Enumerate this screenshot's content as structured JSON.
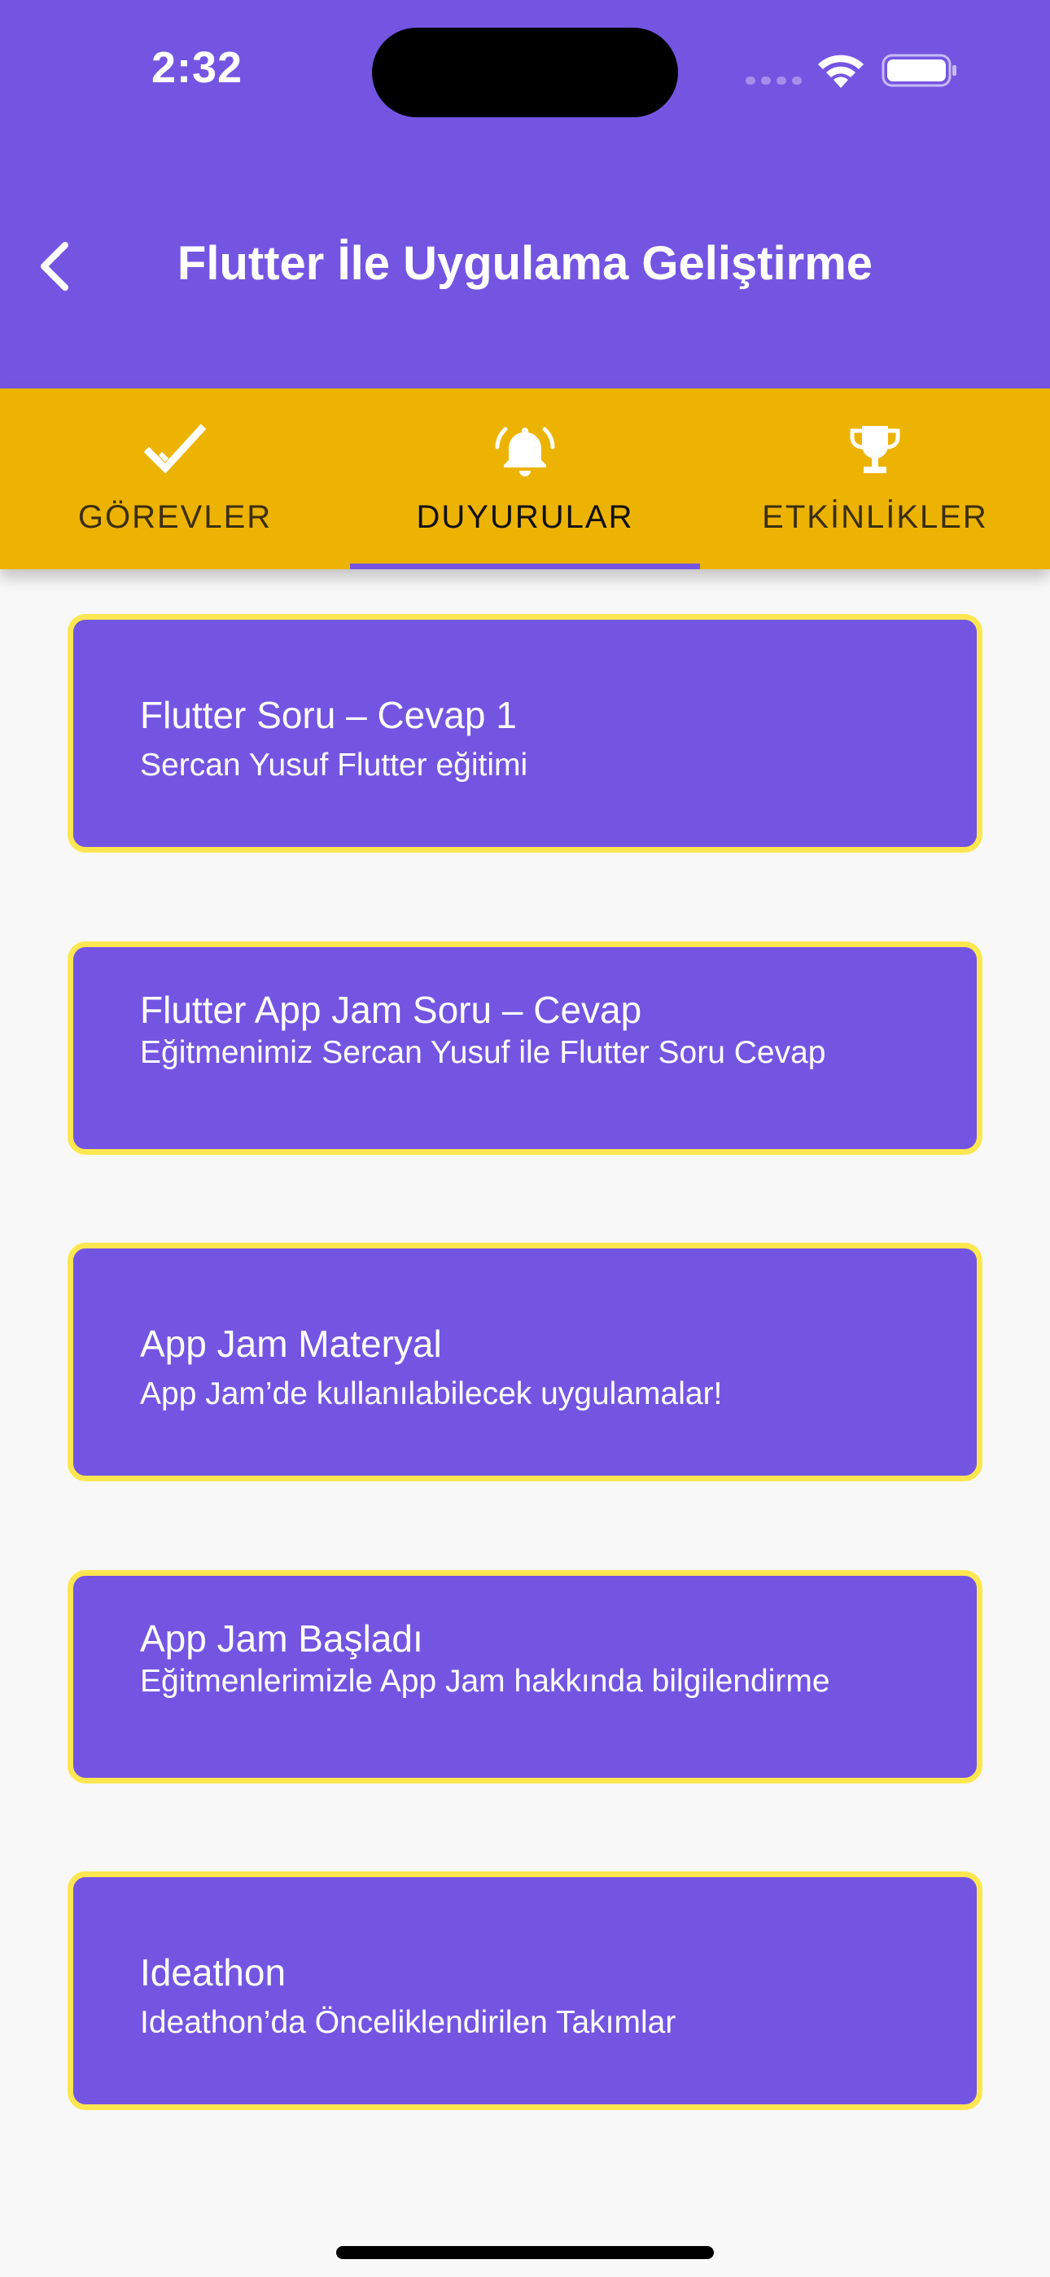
{
  "status_bar": {
    "time": "2:32"
  },
  "app_bar": {
    "title": "Flutter İle Uygulama Geliştirme",
    "back_icon": "chevron-left-icon"
  },
  "tabs": [
    {
      "label": "GÖREVLER",
      "icon": "check-icon",
      "active": false
    },
    {
      "label": "DUYURULAR",
      "icon": "bell-ringing-icon",
      "active": true
    },
    {
      "label": "ETKİNLİKLER",
      "icon": "trophy-icon",
      "active": false
    }
  ],
  "announcements": [
    {
      "title": "Flutter Soru – Cevap 1",
      "subtitle": "Sercan Yusuf Flutter eğitimi"
    },
    {
      "title": "Flutter App Jam Soru – Cevap",
      "subtitle": "Eğitmenimiz Sercan Yusuf ile Flutter Soru Cevap"
    },
    {
      "title": "App Jam Materyal",
      "subtitle": "App Jam’de kullanılabilecek uygulamalar!"
    },
    {
      "title": "App Jam Başladı",
      "subtitle": "Eğitmenlerimizle App Jam hakkında bilgilendirme"
    },
    {
      "title": "Ideathon",
      "subtitle": "Ideathon’da Önceliklendirilen Takımlar"
    }
  ],
  "colors": {
    "primary": "#7455e2",
    "tab_bar": "#edb302",
    "card_border": "#fce751",
    "background": "#f8f8f8"
  }
}
